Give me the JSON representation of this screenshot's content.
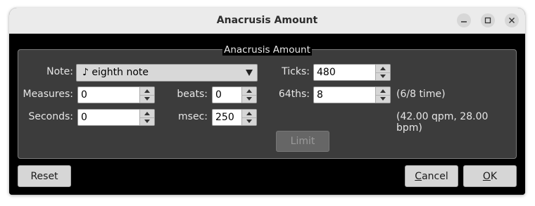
{
  "window": {
    "title": "Anacrusis Amount"
  },
  "group": {
    "legend": "Anacrusis Amount"
  },
  "note": {
    "label": "Note:",
    "value": "♪ eighth note"
  },
  "ticks": {
    "label": "Ticks:",
    "value": "480"
  },
  "measures": {
    "label": "Measures:",
    "value": "0"
  },
  "beats": {
    "label": "beats:",
    "value": "0"
  },
  "sixtyfourths": {
    "label": "64ths:",
    "value": "8",
    "info": "(6/8 time)"
  },
  "seconds": {
    "label": "Seconds:",
    "value": "0"
  },
  "msec": {
    "label": "msec:",
    "value": "250"
  },
  "tempo_info": "(42.00 qpm, 28.00 bpm)",
  "buttons": {
    "limit": "Limit",
    "reset": "Reset",
    "cancel": "Cancel",
    "ok": "OK"
  },
  "icons": [
    "minimize-icon",
    "maximize-icon",
    "close-icon",
    "dropdown-arrow-icon",
    "spin-up-icon",
    "spin-down-icon"
  ]
}
